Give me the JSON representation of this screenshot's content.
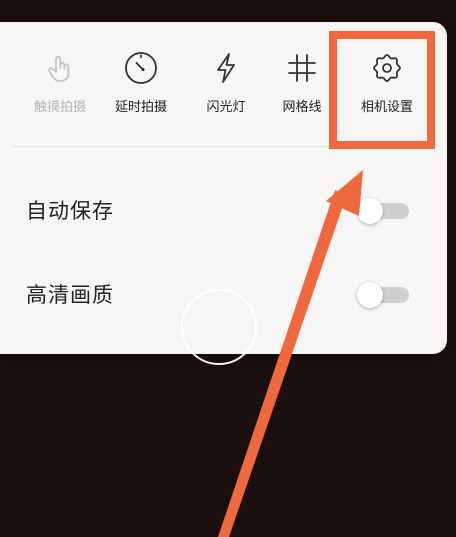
{
  "toolbar": {
    "items": [
      {
        "label": "触摸拍摄",
        "icon": "touch-hand-icon",
        "enabled": false
      },
      {
        "label": "延时拍摄",
        "icon": "timer-dial-icon",
        "enabled": true
      },
      {
        "label": "闪光灯",
        "icon": "lightning-bolt-icon",
        "enabled": true
      },
      {
        "label": "网格线",
        "icon": "grid-icon",
        "enabled": true
      },
      {
        "label": "相机设置",
        "icon": "gear-icon",
        "enabled": true
      }
    ]
  },
  "settings": {
    "auto_save": {
      "label": "自动保存",
      "on": false
    },
    "hd_quality": {
      "label": "高清画质",
      "on": false
    }
  },
  "colors": {
    "highlight": "#f0693e",
    "panel": "#f7f6f4",
    "background": "#1a0f0d",
    "toggle_off_track": "#cfcfcf"
  }
}
